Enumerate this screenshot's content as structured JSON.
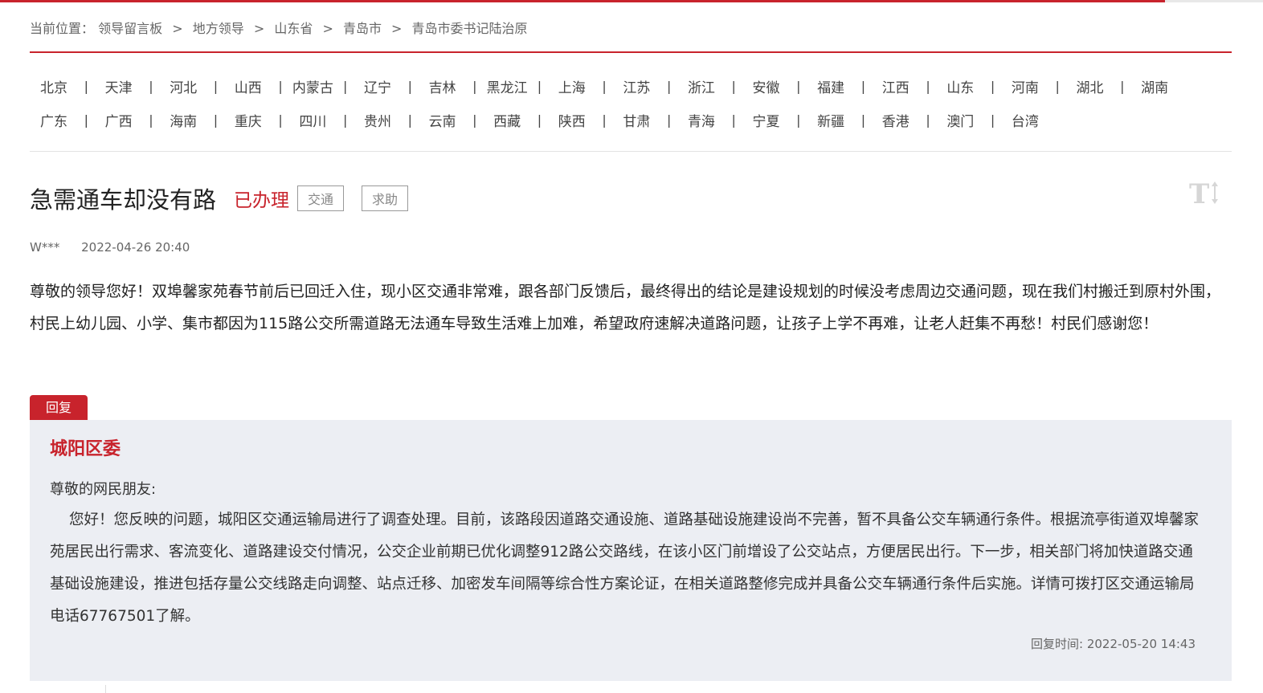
{
  "breadcrumb": {
    "prefix": "当前位置：",
    "items": [
      "领导留言板",
      "地方领导",
      "山东省",
      "青岛市",
      "青岛市委书记陆治原"
    ],
    "separator": ">"
  },
  "regions": {
    "row1": [
      "北京",
      "天津",
      "河北",
      "山西",
      "内蒙古",
      "辽宁",
      "吉林",
      "黑龙江",
      "上海",
      "江苏",
      "浙江",
      "安徽",
      "福建",
      "江西",
      "山东",
      "河南",
      "湖北",
      "湖南"
    ],
    "row2": [
      "广东",
      "广西",
      "海南",
      "重庆",
      "四川",
      "贵州",
      "云南",
      "西藏",
      "陕西",
      "甘肃",
      "青海",
      "宁夏",
      "新疆",
      "香港",
      "澳门",
      "台湾"
    ],
    "separator": "|"
  },
  "message": {
    "title": "急需通车却没有路",
    "status": "已办理",
    "tags": [
      "交通",
      "求助"
    ],
    "author": "W***",
    "date": "2022-04-26 20:40",
    "body": "尊敬的领导您好！双埠馨家苑春节前后已回迁入住，现小区交通非常难，跟各部门反馈后，最终得出的结论是建设规划的时候没考虑周边交通问题，现在我们村搬迁到原村外围，村民上幼儿园、小学、集市都因为115路公交所需道路无法通车导致生活难上加难，希望政府速解决道路问题，让孩子上学不再难，让老人赶集不再愁！村民们感谢您！"
  },
  "reply": {
    "tab_label": "回复",
    "org": "城阳区委",
    "greeting": "尊敬的网民朋友:",
    "text": "您好！您反映的问题，城阳区交通运输局进行了调查处理。目前，该路段因道路交通设施、道路基础设施建设尚不完善，暂不具备公交车辆通行条件。根据流亭街道双埠馨家苑居民出行需求、客流变化、道路建设交付情况，公交企业前期已优化调整912路公交路线，在该小区门前增设了公交站点，方便居民出行。下一步，相关部门将加快道路交通基础设施建设，推进包括存量公交线路走向调整、站点迁移、加密发车间隔等综合性方案论证，在相关道路整修完成并具备公交车辆通行条件后实施。详情可拨打区交通运输局电话67767501了解。",
    "time_label": "回复时间:",
    "time": "2022-05-20 14:43"
  },
  "colors": {
    "accent": "#c8232c",
    "reply_bg": "#eceef3"
  },
  "icons": {
    "font_size_toggle": "font-size-toggle-icon"
  }
}
